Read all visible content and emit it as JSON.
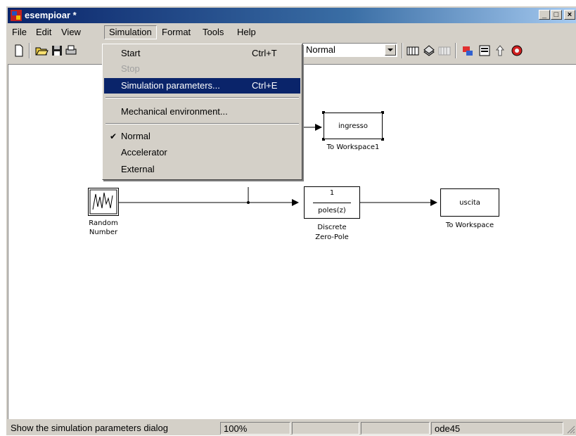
{
  "window": {
    "title": "esempioar *"
  },
  "menubar": {
    "items": [
      "File",
      "Edit",
      "View",
      "Simulation",
      "Format",
      "Tools",
      "Help"
    ]
  },
  "toolbar": {
    "mode_value": "Normal"
  },
  "simulation_menu": {
    "start": {
      "label": "Start",
      "shortcut": "Ctrl+T"
    },
    "stop": {
      "label": "Stop"
    },
    "sim_params": {
      "label": "Simulation parameters...",
      "shortcut": "Ctrl+E"
    },
    "mech_env": {
      "label": "Mechanical environment..."
    },
    "normal": {
      "label": "Normal"
    },
    "accelerator": {
      "label": "Accelerator"
    },
    "external": {
      "label": "External"
    }
  },
  "blocks": {
    "random": {
      "label_line1": "Random",
      "label_line2": "Number"
    },
    "zero_pole": {
      "numerator": "1",
      "denominator": "poles(z)",
      "label_line1": "Discrete",
      "label_line2": "Zero-Pole"
    },
    "to_ws1": {
      "text": "ingresso",
      "label": "To Workspace1"
    },
    "to_ws": {
      "text": "uscita",
      "label": "To Workspace"
    }
  },
  "statusbar": {
    "message": "Show the simulation parameters dialog",
    "zoom": "100%",
    "pane3": "",
    "pane4": "",
    "solver": "ode45"
  }
}
